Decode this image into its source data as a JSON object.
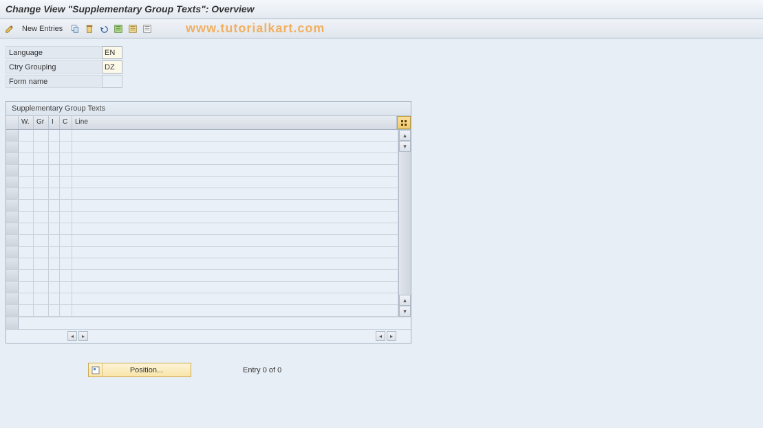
{
  "title": "Change View \"Supplementary Group Texts\": Overview",
  "toolbar": {
    "new_entries": "New Entries"
  },
  "watermark": "www.tutorialkart.com",
  "form": {
    "language_label": "Language",
    "language_value": "EN",
    "ctry_label": "Ctry Grouping",
    "ctry_value": "DZ",
    "formname_label": "Form name",
    "formname_value": ""
  },
  "grid": {
    "title": "Supplementary Group Texts",
    "headers": {
      "w": "W.",
      "gr": "Gr",
      "i": "I",
      "c": "C",
      "line": "Line"
    },
    "rows": [
      {},
      {},
      {},
      {},
      {},
      {},
      {},
      {},
      {},
      {},
      {},
      {},
      {},
      {},
      {},
      {}
    ]
  },
  "status": {
    "position_button": "Position...",
    "entry_text": "Entry 0 of 0"
  }
}
